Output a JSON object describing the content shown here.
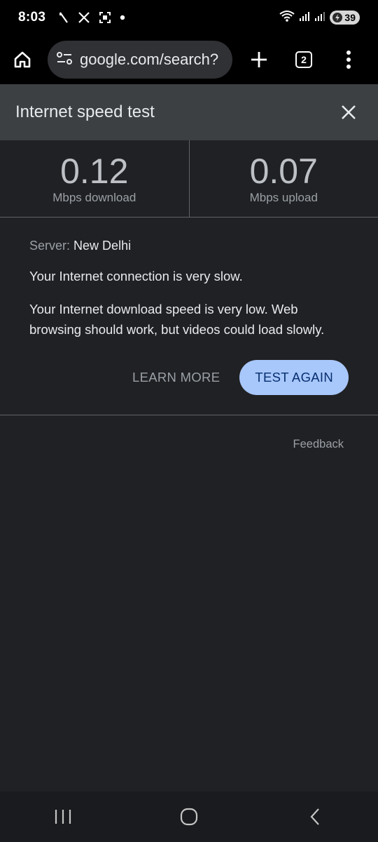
{
  "status_bar": {
    "time": "8:03",
    "battery_level": "39",
    "icons_left": [
      "slash-app-icon",
      "x-icon",
      "screenshot-icon",
      "dot-icon"
    ],
    "icons_right": [
      "wifi-icon",
      "signal-icon",
      "signal-icon",
      "battery-icon"
    ]
  },
  "browser": {
    "url": "google.com/search?",
    "tab_count": "2"
  },
  "speed_test": {
    "title": "Internet speed test",
    "download_value": "0.12",
    "download_label": "Mbps download",
    "upload_value": "0.07",
    "upload_label": "Mbps upload",
    "server_label": "Server:",
    "server_value": "New Delhi",
    "message_1": "Your Internet connection is very slow.",
    "message_2": "Your Internet download speed is very low. Web browsing should work, but videos could load slowly.",
    "learn_more": "LEARN MORE",
    "test_again": "TEST AGAIN",
    "feedback": "Feedback"
  },
  "colors": {
    "background": "#202124",
    "header": "#3c4043",
    "accent_button": "#a8c7fa"
  }
}
